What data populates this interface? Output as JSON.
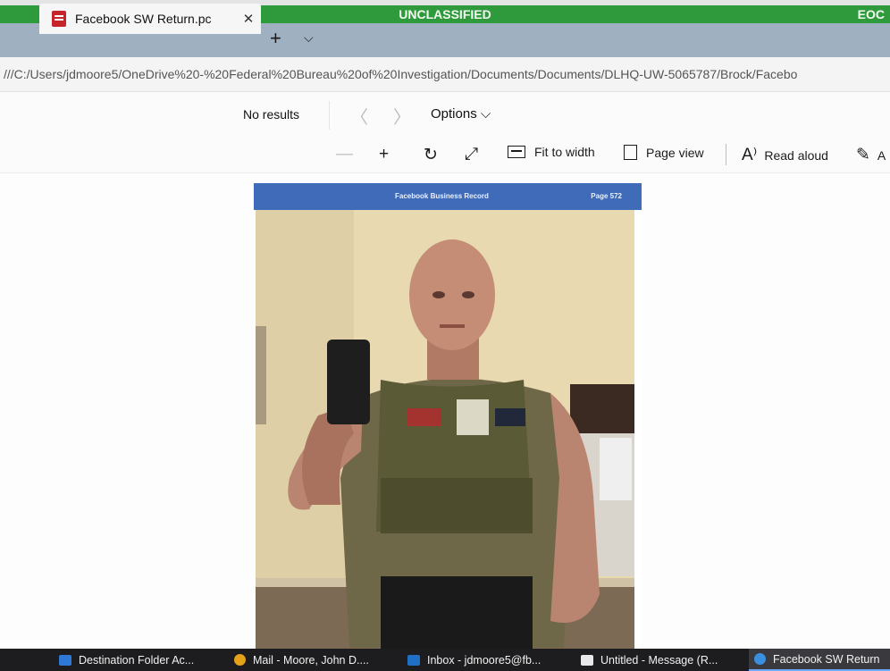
{
  "banner": {
    "center": "UNCLASSIFIED",
    "right": "EOC"
  },
  "tab": {
    "title": "Facebook SW Return.pc",
    "close": "✕"
  },
  "tabbar": {
    "new_tab": "+",
    "tab_list": "⌵"
  },
  "address": {
    "url": "///C:/Users/jdmoore5/OneDrive%20-%20Federal%20Bureau%20of%20Investigation/Documents/Documents/DLHQ-UW-5065787/Brock/Facebo"
  },
  "find": {
    "status": "No results",
    "prev": "〈",
    "next": "〉",
    "options": "Options ⌵"
  },
  "toolbar": {
    "zoom_out": "—",
    "zoom_in": "+",
    "rotate": "↻",
    "fullscreen": "⤢",
    "fit_to_width": "Fit to width",
    "page_view": "Page view",
    "read_aloud_glyph": "A⁾",
    "read_aloud": "Read aloud",
    "draw_glyph": "✎",
    "draw_label": "A"
  },
  "pdf": {
    "header_title": "Facebook Business Record",
    "page_label": "Page 572"
  },
  "taskbar": {
    "items": [
      {
        "label": "Destination Folder Ac...",
        "icon_color": "#2e79d6"
      },
      {
        "label": "Mail - Moore, John D....",
        "icon_color": "#e3a21a"
      },
      {
        "label": "Inbox - jdmoore5@fb...",
        "icon_color": "#1f6fc4"
      },
      {
        "label": "Untitled - Message (R...",
        "icon_color": "#e8e8e8"
      },
      {
        "label": "Facebook SW Return",
        "icon_color": "#3a8fe0"
      }
    ]
  },
  "colors": {
    "banner": "#2f9a3c",
    "pdf_header": "#3f6bb8",
    "tabstrip": "#9fb0c0",
    "taskbar": "#1d1d1f"
  }
}
